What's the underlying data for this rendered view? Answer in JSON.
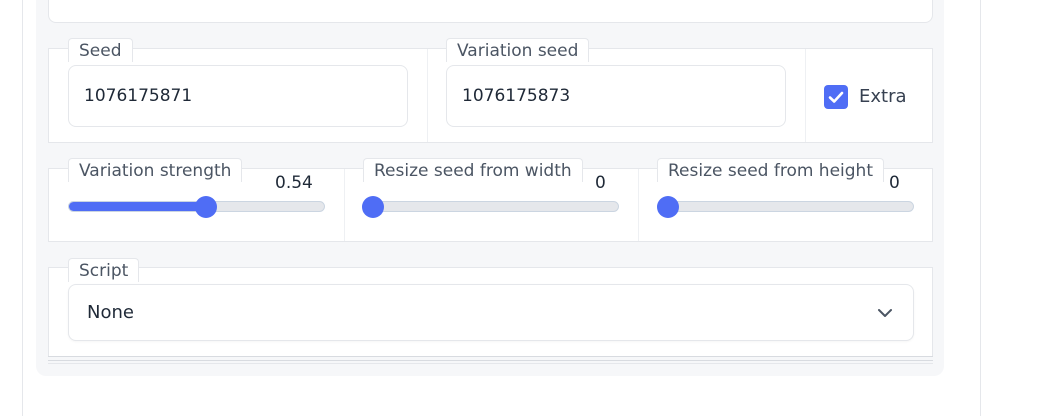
{
  "seed": {
    "label": "Seed",
    "value": "1076175871"
  },
  "variation_seed": {
    "label": "Variation seed",
    "value": "1076175873"
  },
  "extra": {
    "label": "Extra",
    "checked": true
  },
  "sliders": {
    "variation_strength": {
      "label": "Variation strength",
      "value": "0.54",
      "fraction": 0.54
    },
    "resize_seed_width": {
      "label": "Resize seed from width",
      "value": "0",
      "fraction": 0
    },
    "resize_seed_height": {
      "label": "Resize seed from height",
      "value": "0",
      "fraction": 0
    }
  },
  "script": {
    "label": "Script",
    "selected": "None",
    "icon": "chevron-down-icon"
  },
  "colors": {
    "accent": "#4f6df5",
    "panel_bg": "#f6f7f9",
    "border": "#e5e7eb"
  }
}
